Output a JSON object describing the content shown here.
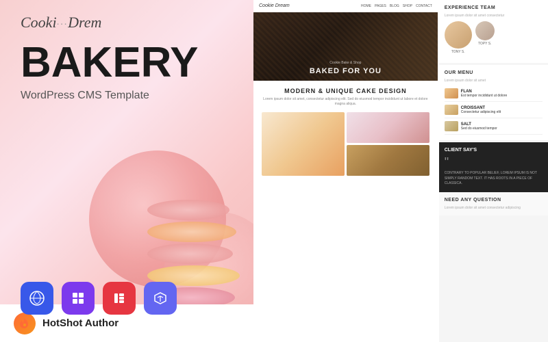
{
  "left": {
    "logo": "Cookie Dream",
    "logo_part1": "Cooki",
    "logo_part2": "Drem",
    "main_title": "BAKERY",
    "subtitle": "WordPress CMS Template",
    "tech_icons": [
      {
        "name": "WordPress",
        "symbol": "W",
        "class": "wp-icon"
      },
      {
        "name": "Quix",
        "symbol": "Q",
        "class": "quix-icon"
      },
      {
        "name": "Elementor",
        "symbol": "E",
        "class": "elementor-icon"
      },
      {
        "name": "UltraFrontend",
        "symbol": "UF",
        "class": "uf-icon"
      }
    ],
    "author": {
      "logo_symbol": "🔥",
      "name": "HotShot Author"
    }
  },
  "website_preview": {
    "nav": {
      "brand": "Cookie Dream",
      "links": [
        "HOME",
        "PAGES",
        "BLOG",
        "SHOP",
        "CONTACT"
      ]
    },
    "hero": {
      "text": "BAKED FOR YOU",
      "sub": "Cookie Bake & Shop"
    },
    "section1": {
      "title": "MODERN & UNIQUE CAKE DESIGN",
      "desc": "Lorem ipsum dolor sit amet, consectetur adipiscing elit. Sed do eiusmod tempor incididunt ut labore et dolore magna aliqua."
    },
    "side": {
      "team_title": "RIENCE TEAM",
      "team_members": [
        {
          "name": "TONY S."
        },
        {
          "name": "TOPY S."
        }
      ],
      "menu_title": "OUR MENU",
      "menu_items": [
        {
          "name": "FLAN",
          "desc": "Est tempor incididunt ut dolore"
        },
        {
          "name": "CROISSANT",
          "desc": "Consectetur adipiscing elit"
        },
        {
          "name": "SALT",
          "desc": "Sed do eiusmod tempor"
        }
      ],
      "client_title": "CLIENT SAY'S",
      "client_quote": "CONTRARY TO POPULAR BELIEF, LOREM IPSUM IS NOT SIMPLY RANDOM TEXT. IT HAS ROOTS IN A PIECE OF CLASSICA.",
      "faq_title": "ED ANY QUESTION"
    }
  }
}
